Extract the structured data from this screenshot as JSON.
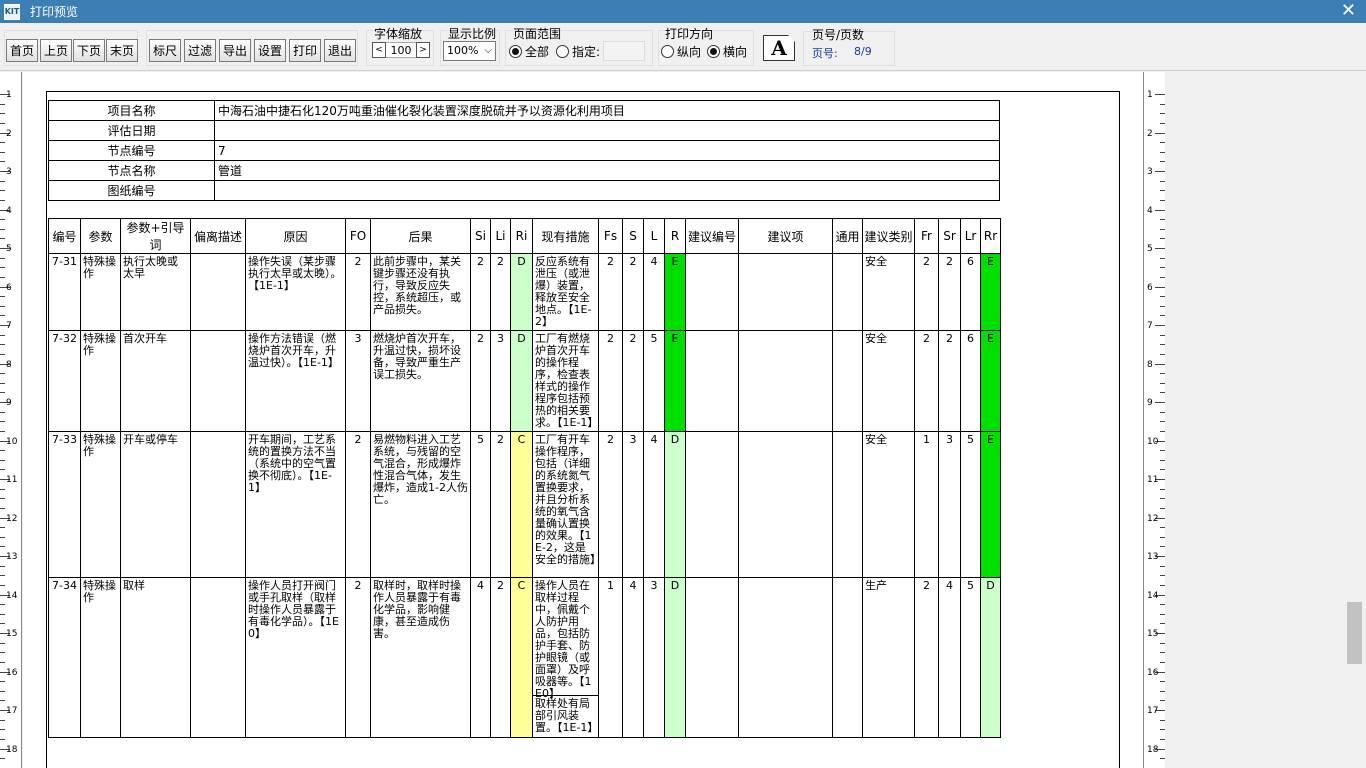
{
  "window": {
    "title": "打印预览",
    "app_icon": "kit-icon",
    "close": "✕"
  },
  "toolbar": {
    "nav": [
      "首页",
      "上页",
      "下页",
      "末页"
    ],
    "actions": [
      "标尺",
      "过滤",
      "导出",
      "设置",
      "打印",
      "退出"
    ],
    "font_zoom": {
      "label": "字体缩放",
      "dec": "<",
      "value": "100",
      "inc": ">"
    },
    "display_ratio": {
      "label": "显示比例",
      "value": "100%"
    },
    "page_range": {
      "label": "页面范围",
      "all": "全部",
      "specified": "指定:",
      "selected": "all"
    },
    "orientation": {
      "label": "打印方向",
      "portrait": "纵向",
      "landscape": "横向",
      "selected": "landscape"
    },
    "font_button": "A",
    "page_info": {
      "label": "页号/页数",
      "prefix": "页号:",
      "value": "8/9"
    }
  },
  "ruler": {
    "numbers": [
      "1",
      "2",
      "3",
      "4",
      "5",
      "6",
      "7",
      "8",
      "9",
      "10",
      "11",
      "12",
      "13",
      "14",
      "15",
      "16",
      "17",
      "18"
    ]
  },
  "info_table": [
    {
      "key": "项目名称",
      "value": "中海石油中捷石化120万吨重油催化裂化装置深度脱硫并予以资源化利用项目"
    },
    {
      "key": "评估日期",
      "value": ""
    },
    {
      "key": "节点编号",
      "value": "7"
    },
    {
      "key": "节点名称",
      "value": "管道"
    },
    {
      "key": "图纸编号",
      "value": ""
    }
  ],
  "main_table": {
    "headers": [
      "编号",
      "参数",
      "参数+引导词",
      "偏离描述",
      "原因",
      "FO",
      "后果",
      "Si",
      "Li",
      "Ri",
      "现有措施",
      "Fs",
      "S",
      "L",
      "R",
      "建议编号",
      "建议项",
      "通用",
      "建议类别",
      "Fr",
      "Sr",
      "Lr",
      "Rr"
    ],
    "rows": [
      {
        "id": "7-31",
        "param": "特殊操作",
        "guide": "执行太晚或太早",
        "deviation": "",
        "cause": "操作失误（某步骤执行太早或太晚）。【1E-1】",
        "fo": "2",
        "consequence": "此前步骤中，某关键步骤还没有执行，导致反应失控，系统超压，或产品损失。",
        "si": "2",
        "li": "2",
        "ri": "D",
        "measure": "反应系统有泄压（或泄爆）装置，释放至安全地点。【1E-2】",
        "fs": "2",
        "s": "2",
        "l": "4",
        "r": "E",
        "sug_no": "",
        "sug": "",
        "general": "",
        "category": "安全",
        "fr": "2",
        "sr": "2",
        "lr": "6",
        "rr": "E"
      },
      {
        "id": "7-32",
        "param": "特殊操作",
        "guide": "首次开车",
        "deviation": "",
        "cause": "操作方法错误（燃烧炉首次开车，升温过快）。【1E-1】",
        "fo": "3",
        "consequence": "燃烧炉首次开车，升温过快，损坏设备，导致严重生产误工损失。",
        "si": "2",
        "li": "3",
        "ri": "D",
        "measure": "工厂有燃烧炉首次开车的操作程序，检查表样式的操作程序包括预热的相关要求。【1E-1】",
        "fs": "2",
        "s": "2",
        "l": "5",
        "r": "E",
        "sug_no": "",
        "sug": "",
        "general": "",
        "category": "安全",
        "fr": "2",
        "sr": "2",
        "lr": "6",
        "rr": "E"
      },
      {
        "id": "7-33",
        "param": "特殊操作",
        "guide": "开车或停车",
        "deviation": "",
        "cause": "开车期间，工艺系统的置换方法不当（系统中的空气置换不彻底）。【1E-1】",
        "fo": "2",
        "consequence": "易燃物料进入工艺系统，与残留的空气混合，形成爆炸性混合气体，发生爆炸，造成1-2人伤亡。",
        "si": "5",
        "li": "2",
        "ri": "C",
        "measure": "工厂有开车操作程序，包括（详细的系统氮气置换要求，并且分析系统的氧气含量确认置换的效果。【1E-2，这是安全的措施】",
        "fs": "2",
        "s": "3",
        "l": "4",
        "r": "D",
        "sug_no": "",
        "sug": "",
        "general": "",
        "category": "安全",
        "fr": "1",
        "sr": "3",
        "lr": "5",
        "rr": "E"
      },
      {
        "id": "7-34",
        "param": "特殊操作",
        "guide": "取样",
        "deviation": "",
        "cause": "操作人员打开阀门或手孔取样（取样时操作人员暴露于有毒化学品）。【1E0】",
        "fo": "2",
        "consequence": "取样时，取样时操作人员暴露于有毒化学品，影响健康，甚至造成伤害。",
        "si": "4",
        "li": "2",
        "ri": "C",
        "measure": "操作人员在取样过程中，佩戴个人防护用品，包括防护手套、防护眼镜（或面罩）及呼吸器等。【1E0】",
        "measure2": "取样处有局部引风装置。【1E-1】",
        "fs": "1",
        "s": "4",
        "l": "3",
        "r": "D",
        "sug_no": "",
        "sug": "",
        "general": "",
        "category": "生产",
        "fr": "2",
        "sr": "4",
        "lr": "5",
        "rr": "D"
      }
    ]
  },
  "colors": {
    "titlebar": "#3c7fb4",
    "risk_e": "#00e000",
    "risk_d": "#ccffcc",
    "risk_c": "#ffff99"
  }
}
